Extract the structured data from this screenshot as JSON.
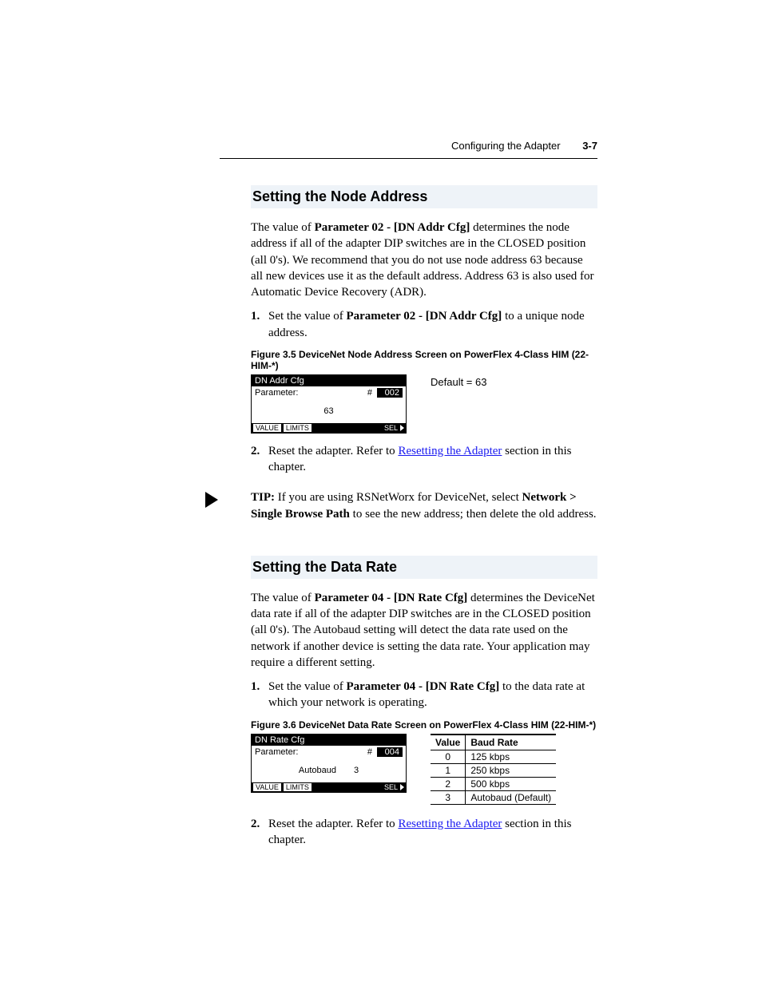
{
  "header": {
    "section": "Configuring the Adapter",
    "page": "3-7"
  },
  "node_addr": {
    "heading": "Setting the Node Address",
    "para_pre": "The value of ",
    "para_bold": "Parameter 02 - [DN Addr Cfg]",
    "para_post": " determines the node address if all of the adapter DIP switches are in the CLOSED position (all 0's). We recommend that you do not use node address 63 because all new devices use it as the default address. Address 63 is also used for Automatic Device Recovery (ADR).",
    "step1_num": "1.",
    "step1_pre": "Set the value of ",
    "step1_bold": "Parameter 02 - [DN Addr Cfg]",
    "step1_post": " to a unique node address.",
    "figcap": "Figure 3.5   DeviceNet Node Address Screen on PowerFlex 4-Class HIM (22-HIM-*)",
    "him": {
      "title": "DN Addr Cfg",
      "row_label": "Parameter:",
      "hash": "#",
      "num": "002",
      "value": "63",
      "value2": "",
      "foot_value": "VALUE",
      "foot_limits": "LIMITS",
      "foot_sel": "SEL"
    },
    "default_note": "Default = 63",
    "step2_num": "2.",
    "step2_pre": "Reset the adapter. Refer to ",
    "step2_link": "Resetting the Adapter",
    "step2_post": " section in this chapter.",
    "tip_label": "TIP:",
    "tip_pre": "  If you are using RSNetWorx for DeviceNet, select ",
    "tip_bold1": "Network > Single Browse Path",
    "tip_post": " to see the new address; then delete the old address."
  },
  "data_rate": {
    "heading": "Setting the Data Rate",
    "para_pre": "The value of ",
    "para_bold": "Parameter 04 - [DN Rate Cfg]",
    "para_post": " determines the DeviceNet data rate if all of the adapter DIP switches are in the CLOSED position (all 0's). The Autobaud setting will detect the data rate used on the network if another device is setting the data rate. Your application may require a different setting.",
    "step1_num": "1.",
    "step1_pre": "Set the value of ",
    "step1_bold": "Parameter 04 - [DN Rate Cfg]",
    "step1_post": " to the data rate at which your network is operating.",
    "figcap": "Figure 3.6   DeviceNet Data Rate Screen on PowerFlex 4-Class HIM (22-HIM-*)",
    "him": {
      "title": "DN Rate Cfg",
      "row_label": "Parameter:",
      "hash": "#",
      "num": "004",
      "value": "Autobaud",
      "value2": "3",
      "foot_value": "VALUE",
      "foot_limits": "LIMITS",
      "foot_sel": "SEL"
    },
    "table": {
      "h1": "Value",
      "h2": "Baud Rate",
      "rows": [
        {
          "v": "0",
          "b": "125 kbps"
        },
        {
          "v": "1",
          "b": "250 kbps"
        },
        {
          "v": "2",
          "b": "500 kbps"
        },
        {
          "v": "3",
          "b": "Autobaud (Default)"
        }
      ]
    },
    "step2_num": "2.",
    "step2_pre": "Reset the adapter. Refer to ",
    "step2_link": "Resetting the Adapter",
    "step2_post": " section in this chapter."
  }
}
